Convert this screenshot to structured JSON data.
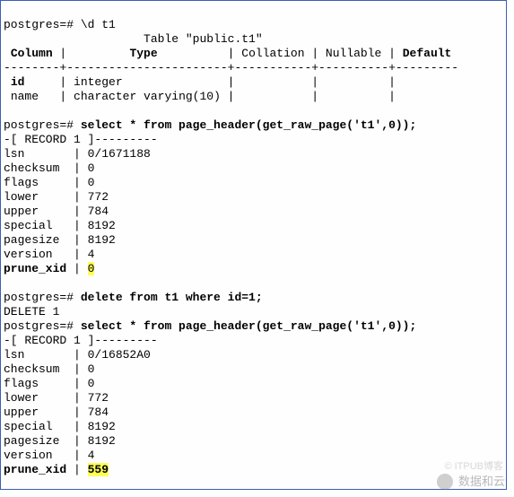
{
  "prompt": "postgres=#",
  "cmd1": "\\d t1",
  "table_title": "Table \"public.t1\"",
  "hdr_column": "Column",
  "hdr_type": "Type",
  "hdr_collation": "Collation",
  "hdr_nullable": "Nullable",
  "hdr_default": "Default",
  "sep_line": "--------+-----------------------+-----------+----------+---------",
  "col_id": "id",
  "col_id_type": "integer",
  "col_name": "name",
  "col_name_type": "character varying(10)",
  "cmd2": "select * from page_header(get_raw_page('t1',0));",
  "record_header": "-[ RECORD 1 ]---------",
  "fields1": {
    "lsn": "0/1671188",
    "checksum": "0",
    "flags": "0",
    "lower": "772",
    "upper": "784",
    "special": "8192",
    "pagesize": "8192",
    "version": "4"
  },
  "prune_xid_label": "prune_xid",
  "prune_xid_val1": "0",
  "cmd3": "delete from t1 where id=1;",
  "delete_result": "DELETE 1",
  "cmd4": "select * from page_header(get_raw_page('t1',0));",
  "fields2": {
    "lsn": "0/16852A0",
    "checksum": "0",
    "flags": "0",
    "lower": "772",
    "upper": "784",
    "special": "8192",
    "pagesize": "8192",
    "version": "4"
  },
  "prune_xid_val2": "559",
  "labels": {
    "lsn": "lsn",
    "checksum": "checksum",
    "flags": "flags",
    "lower": "lower",
    "upper": "upper",
    "special": "special",
    "pagesize": "pagesize",
    "version": "version"
  },
  "watermark_main": "数据和云",
  "watermark_sub": "© ITPUB博客"
}
